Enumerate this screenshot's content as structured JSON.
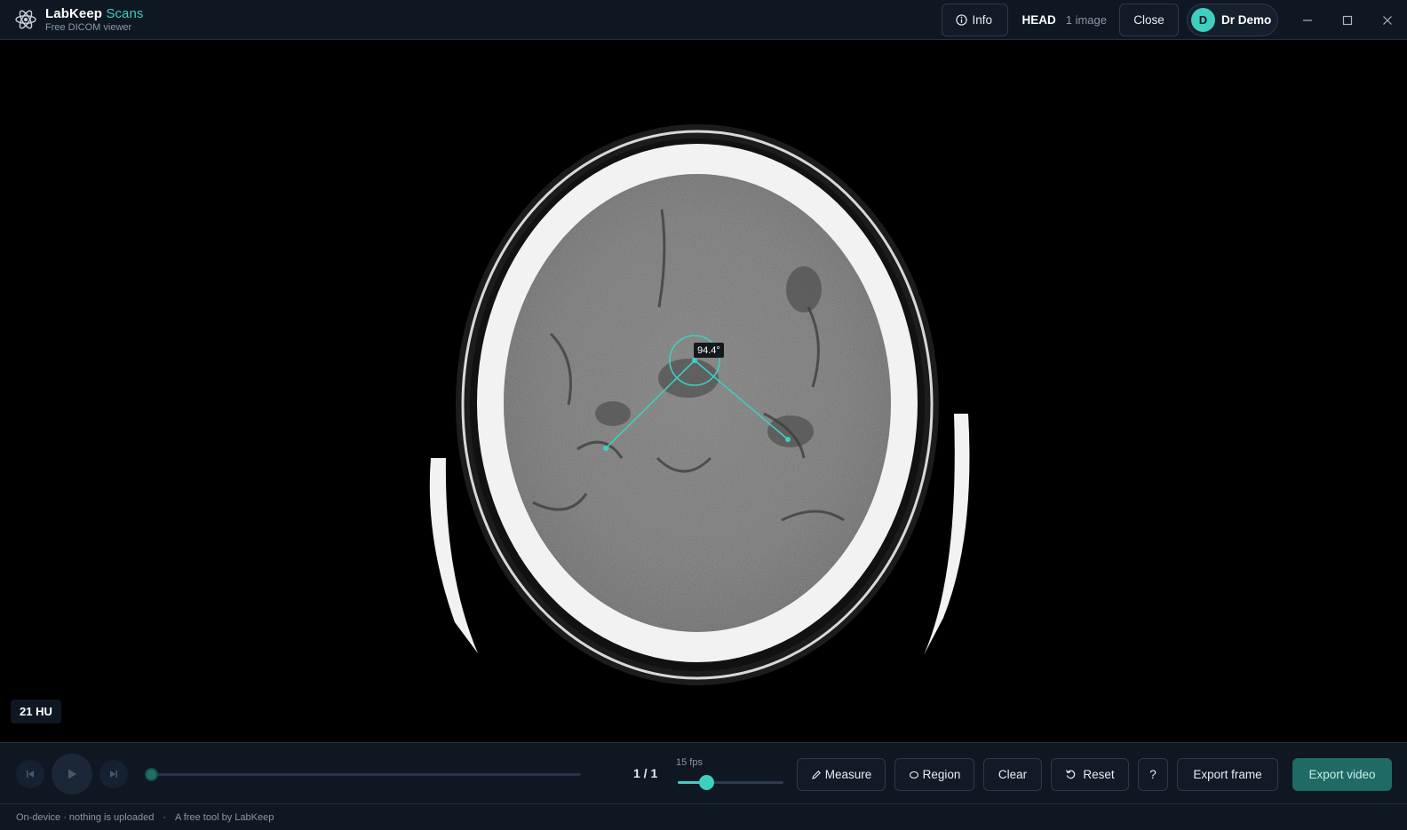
{
  "brand": {
    "name": "LabKeep",
    "product": "Scans",
    "subtitle": "Free DICOM viewer"
  },
  "header": {
    "info_label": "Info",
    "series_name": "HEAD",
    "series_count": "1 image",
    "close_label": "Close",
    "user": {
      "initial": "D",
      "name": "Dr Demo"
    },
    "window_controls": [
      "minimize-icon",
      "maximize-icon",
      "close-icon"
    ]
  },
  "viewer": {
    "hu_readout": "21 HU",
    "angle_measurement": "94.4°",
    "accent_color": "#3ecfbf"
  },
  "playback": {
    "frame_counter": "1 / 1",
    "fps_label": "15 fps",
    "fps_fraction": 0.27,
    "timeline_fraction": 0.0
  },
  "tools": {
    "measure": "Measure",
    "region": "Region",
    "clear": "Clear",
    "reset": "Reset",
    "help": "?",
    "export_frame": "Export frame",
    "export_video": "Export video"
  },
  "footer": {
    "privacy": "On-device · nothing is uploaded",
    "separator": "·",
    "credit": "A free tool by LabKeep"
  }
}
